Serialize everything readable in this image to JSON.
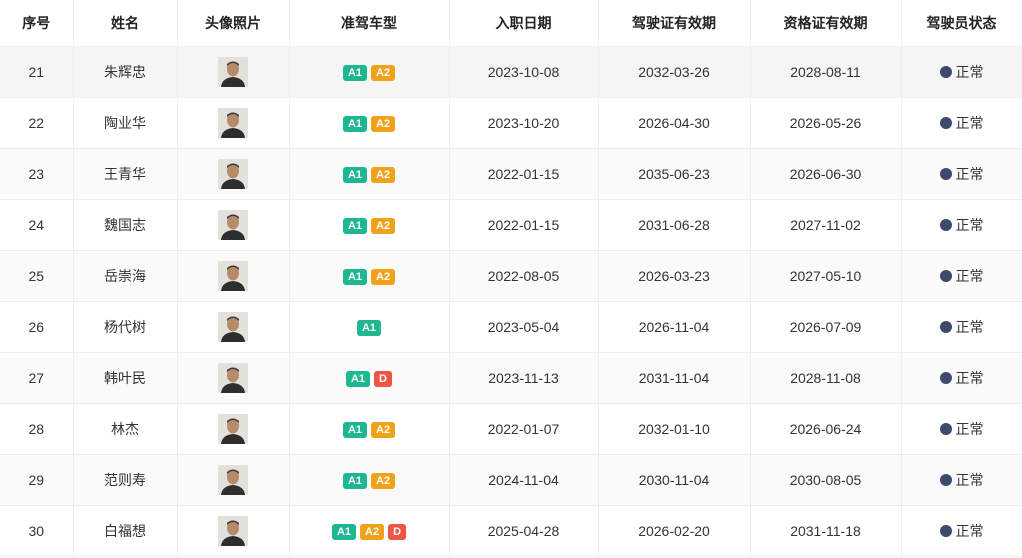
{
  "columns": [
    "序号",
    "姓名",
    "头像照片",
    "准驾车型",
    "入职日期",
    "驾驶证有效期",
    "资格证有效期",
    "驾驶员状态"
  ],
  "colors": {
    "A1": "#1fb791",
    "A2": "#f0a21a",
    "D": "#ee5543",
    "status_dot": "#3d4a6b"
  },
  "rows": [
    {
      "no": "21",
      "name": "朱辉忠",
      "photo_icon": "driver-photo",
      "classes": [
        "A1",
        "A2"
      ],
      "hire_date": "2023-10-08",
      "license_expiry": "2032-03-26",
      "cert_expiry": "2028-08-11",
      "status": "正常"
    },
    {
      "no": "22",
      "name": "陶业华",
      "photo_icon": "driver-photo",
      "classes": [
        "A1",
        "A2"
      ],
      "hire_date": "2023-10-20",
      "license_expiry": "2026-04-30",
      "cert_expiry": "2026-05-26",
      "status": "正常"
    },
    {
      "no": "23",
      "name": "王青华",
      "photo_icon": "driver-photo",
      "classes": [
        "A1",
        "A2"
      ],
      "hire_date": "2022-01-15",
      "license_expiry": "2035-06-23",
      "cert_expiry": "2026-06-30",
      "status": "正常"
    },
    {
      "no": "24",
      "name": "魏国志",
      "photo_icon": "driver-photo",
      "classes": [
        "A1",
        "A2"
      ],
      "hire_date": "2022-01-15",
      "license_expiry": "2031-06-28",
      "cert_expiry": "2027-11-02",
      "status": "正常"
    },
    {
      "no": "25",
      "name": "岳崇海",
      "photo_icon": "driver-photo",
      "classes": [
        "A1",
        "A2"
      ],
      "hire_date": "2022-08-05",
      "license_expiry": "2026-03-23",
      "cert_expiry": "2027-05-10",
      "status": "正常"
    },
    {
      "no": "26",
      "name": "杨代树",
      "photo_icon": "driver-photo",
      "classes": [
        "A1"
      ],
      "hire_date": "2023-05-04",
      "license_expiry": "2026-11-04",
      "cert_expiry": "2026-07-09",
      "status": "正常"
    },
    {
      "no": "27",
      "name": "韩叶民",
      "photo_icon": "driver-photo",
      "classes": [
        "A1",
        "D"
      ],
      "hire_date": "2023-11-13",
      "license_expiry": "2031-11-04",
      "cert_expiry": "2028-11-08",
      "status": "正常"
    },
    {
      "no": "28",
      "name": "林杰",
      "photo_icon": "driver-photo",
      "classes": [
        "A1",
        "A2"
      ],
      "hire_date": "2022-01-07",
      "license_expiry": "2032-01-10",
      "cert_expiry": "2026-06-24",
      "status": "正常"
    },
    {
      "no": "29",
      "name": "范则寿",
      "photo_icon": "driver-photo",
      "classes": [
        "A1",
        "A2"
      ],
      "hire_date": "2024-11-04",
      "license_expiry": "2030-11-04",
      "cert_expiry": "2030-08-05",
      "status": "正常"
    },
    {
      "no": "30",
      "name": "白福想",
      "photo_icon": "driver-photo",
      "classes": [
        "A1",
        "A2",
        "D"
      ],
      "hire_date": "2025-04-28",
      "license_expiry": "2026-02-20",
      "cert_expiry": "2031-11-18",
      "status": "正常"
    }
  ]
}
